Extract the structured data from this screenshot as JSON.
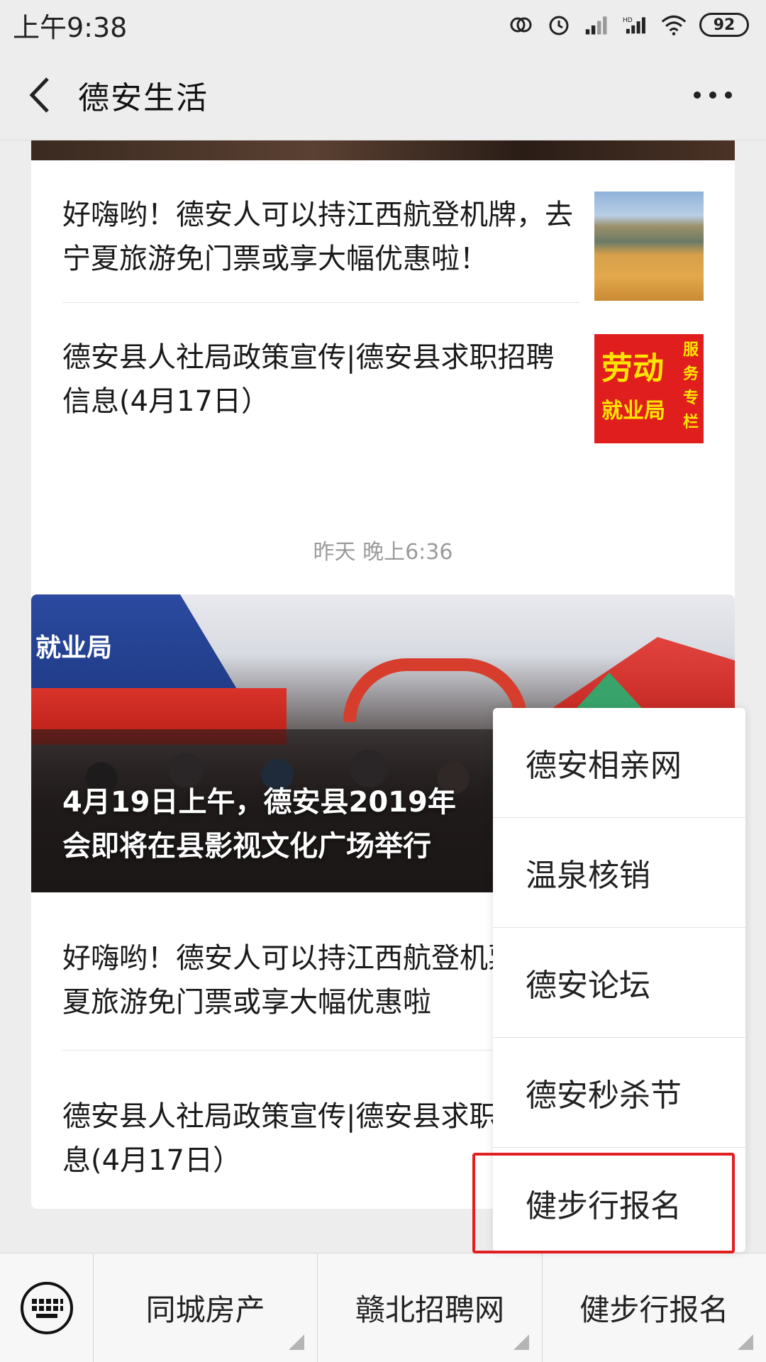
{
  "status_bar": {
    "time": "上午9:38",
    "battery": "92",
    "icons": [
      "sync-icon",
      "alarm-icon",
      "signal-icon",
      "hd-signal-icon",
      "wifi-icon",
      "battery-icon"
    ]
  },
  "header": {
    "title": "德安生活",
    "back_icon": "chevron-left-icon",
    "more_icon": "more-dots-icon"
  },
  "feed": {
    "card1": {
      "articles": [
        {
          "title": "好嗨哟！德安人可以持江西航登机牌，去宁夏旅游免门票或享大幅优惠啦！",
          "thumb": "desert-photo"
        },
        {
          "title": "德安县人社局政策宣传|德安县求职招聘信息(4月17日）",
          "thumb": "labor-bureau-logo"
        }
      ],
      "labor_logo": {
        "main": "劳动",
        "sub": "就业局",
        "side": "服务专栏"
      }
    },
    "timestamp": "昨天 晚上6:36",
    "card2": {
      "hero_title": "4月19日上午，德安县2019年",
      "hero_title_line2": "会即将在县影视文化广场举行",
      "hero_tent_text": "就业局",
      "articles": [
        {
          "title": "好嗨哟！德安人可以持江西航登机票，去宁夏旅游免门票或享大幅优惠啦"
        },
        {
          "title": "德安县人社局政策宣传|德安县求职招聘信息(4月17日）"
        }
      ]
    }
  },
  "bottom_menu": {
    "keyboard_icon": "keyboard-icon",
    "tabs": [
      "同城房产",
      "赣北招聘网",
      "健步行报名"
    ]
  },
  "popup_menu": {
    "items": [
      "德安相亲网",
      "温泉核销",
      "德安论坛",
      "德安秒杀节",
      "健步行报名"
    ],
    "highlighted_item": "健步行报名",
    "highlight_color": "#e02020"
  }
}
